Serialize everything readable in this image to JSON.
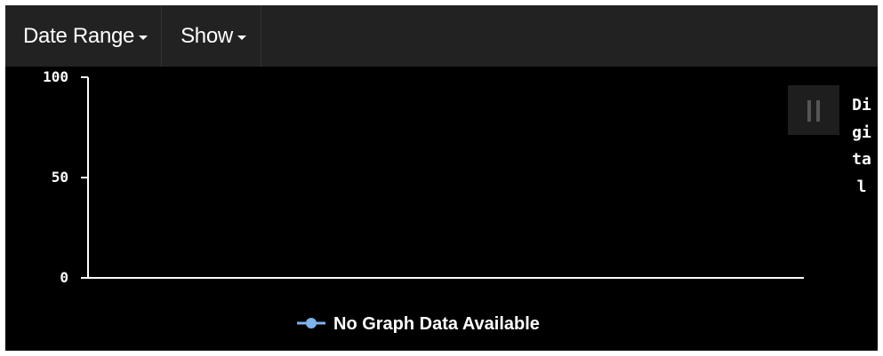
{
  "toolbar": {
    "date_range_label": "Date Range",
    "show_label": "Show"
  },
  "side_label": "Digital",
  "chart_data": {
    "type": "line",
    "y_ticks": [
      "100",
      "50",
      "0"
    ],
    "ylim": [
      0,
      100
    ],
    "series": [
      {
        "name": "No Graph Data Available",
        "values": []
      }
    ],
    "legend_position": "bottom-center",
    "colors": {
      "background": "#000000",
      "axis": "#ffffff",
      "series": "#7cb5ec"
    }
  }
}
